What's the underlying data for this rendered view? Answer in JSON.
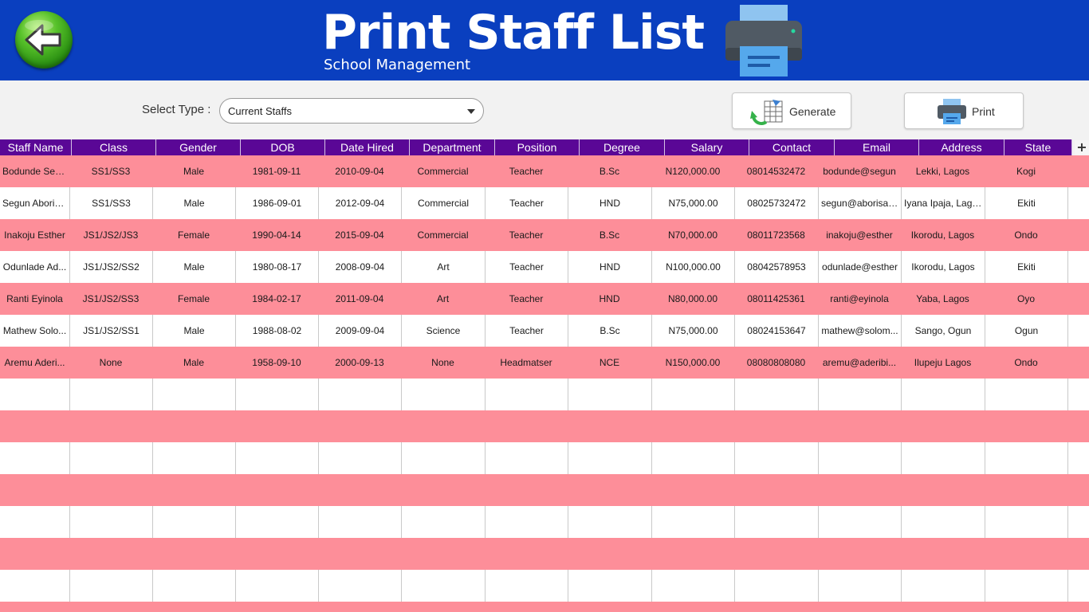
{
  "header": {
    "title": "Print Staff List",
    "subtitle": "School Management",
    "back_icon": "arrow-left-icon",
    "logo_icon": "printer-icon"
  },
  "toolbar": {
    "select_label": "Select Type :",
    "select_value": "Current Staffs",
    "generate_label": "Generate",
    "print_label": "Print"
  },
  "colors": {
    "header_bg": "#0a3fbf",
    "column_header_bg": "#5a0796",
    "row_pink": "#fd8e99",
    "row_white": "#ffffff"
  },
  "table": {
    "columns": [
      "Staff Name",
      "Class",
      "Gender",
      "DOB",
      "Date Hired",
      "Department",
      "Position",
      "Degree",
      "Salary",
      "Contact",
      "Email",
      "Address",
      "State"
    ],
    "add_column_icon": "plus-icon",
    "rows": [
      [
        "Bodunde Seg...",
        "SS1/SS3",
        "Male",
        "1981-09-11",
        "2010-09-04",
        "Commercial",
        "Teacher",
        "B.Sc",
        "N120,000.00",
        "08014532472",
        "bodunde@segun",
        "Lekki, Lagos",
        "Kogi"
      ],
      [
        "Segun Aboria...",
        "SS1/SS3",
        "Male",
        "1986-09-01",
        "2012-09-04",
        "Commercial",
        "Teacher",
        "HND",
        "N75,000.00",
        "08025732472",
        "segun@aborisade",
        "Iyana Ipaja, Lagos",
        "Ekiti"
      ],
      [
        "Inakoju Esther",
        "JS1/JS2/JS3",
        "Female",
        "1990-04-14",
        "2015-09-04",
        "Commercial",
        "Teacher",
        "B.Sc",
        "N70,000.00",
        "08011723568",
        "inakoju@esther",
        "Ikorodu, Lagos",
        "Ondo"
      ],
      [
        "Odunlade Ad...",
        "JS1/JS2/SS2",
        "Male",
        "1980-08-17",
        "2008-09-04",
        "Art",
        "Teacher",
        "HND",
        "N100,000.00",
        "08042578953",
        "odunlade@esther",
        "Ikorodu, Lagos",
        "Ekiti"
      ],
      [
        "Ranti Eyinola",
        "JS1/JS2/SS3",
        "Female",
        "1984-02-17",
        "2011-09-04",
        "Art",
        "Teacher",
        "HND",
        "N80,000.00",
        "08011425361",
        "ranti@eyinola",
        "Yaba, Lagos",
        "Oyo"
      ],
      [
        "Mathew Solo...",
        "JS1/JS2/SS1",
        "Male",
        "1988-08-02",
        "2009-09-04",
        "Science",
        "Teacher",
        "B.Sc",
        "N75,000.00",
        "08024153647",
        "mathew@solom...",
        "Sango, Ogun",
        "Ogun"
      ],
      [
        "Aremu Aderi...",
        "None",
        "Male",
        "1958-09-10",
        "2000-09-13",
        "None",
        "Headmatser",
        "NCE",
        "N150,000.00",
        "08080808080",
        "aremu@aderibi...",
        "Ilupeju Lagos",
        "Ondo"
      ]
    ]
  }
}
